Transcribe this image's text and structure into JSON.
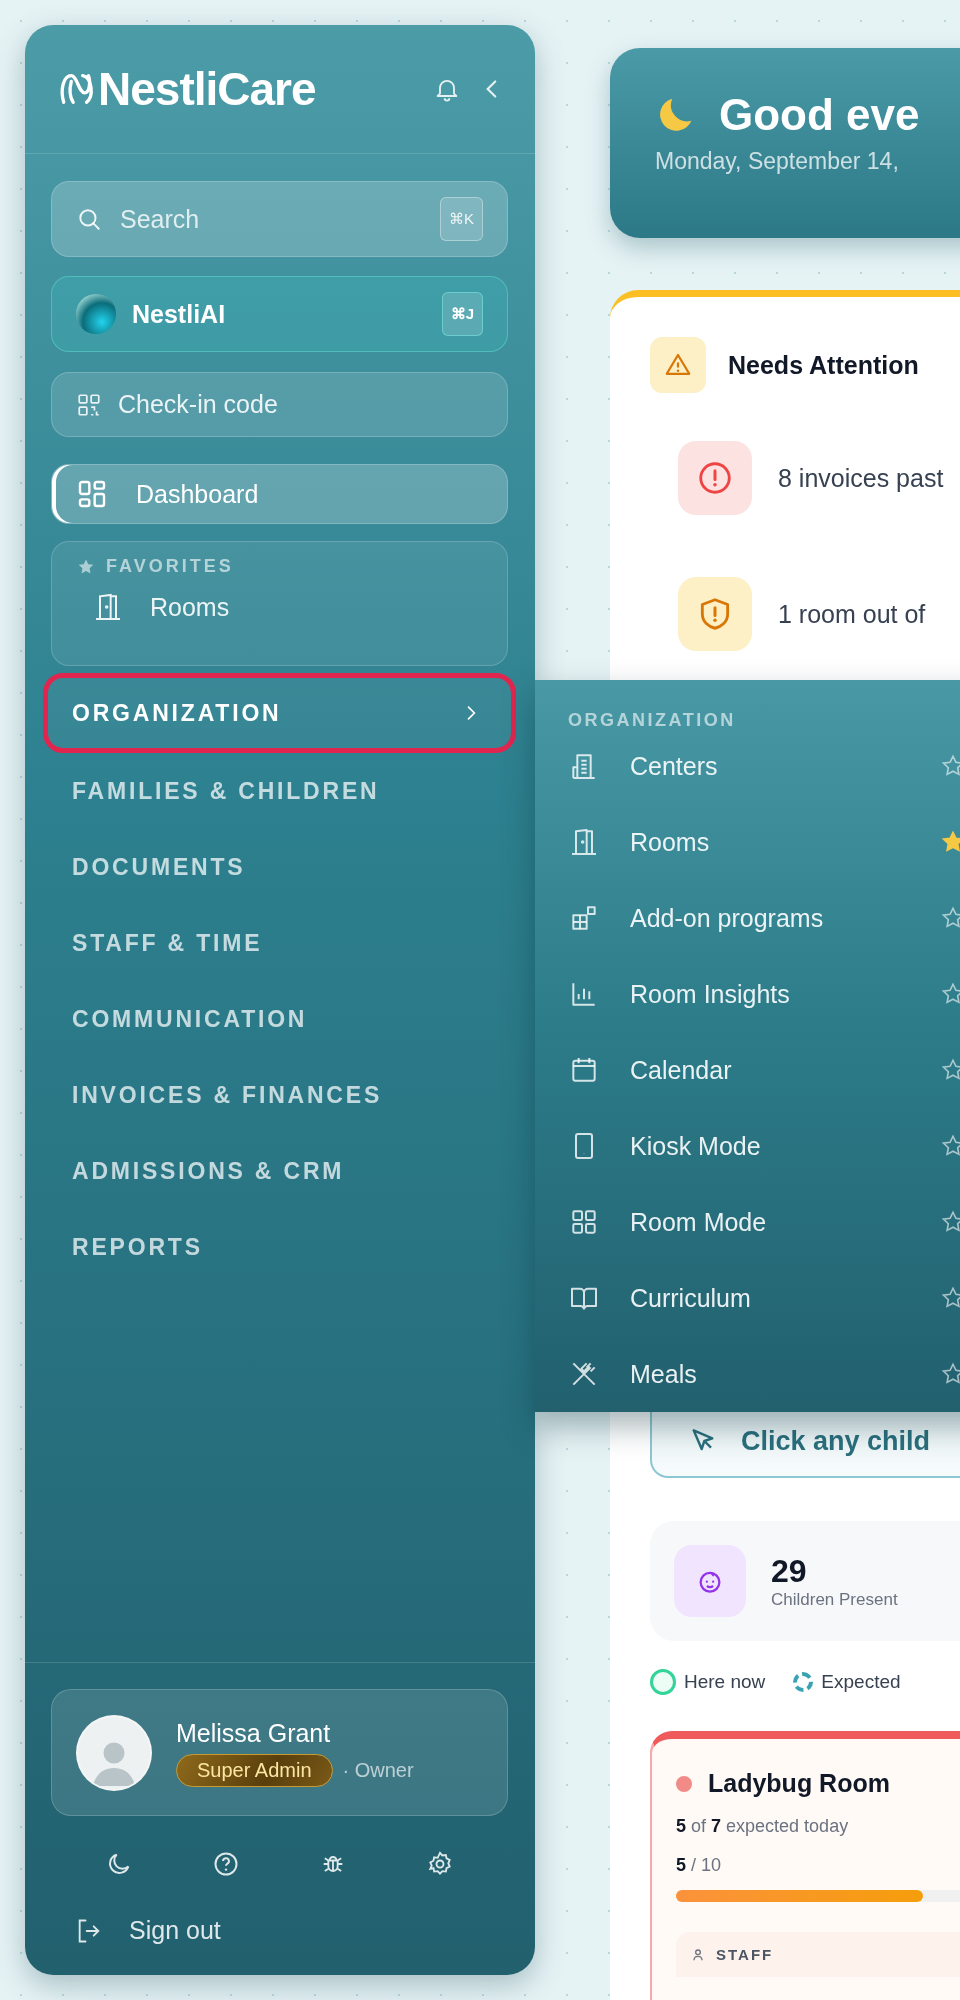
{
  "sidebar": {
    "logo": "NestliCare",
    "search": {
      "placeholder": "Search",
      "shortcut": "⌘K"
    },
    "assistant": {
      "label": "NestliAI",
      "shortcut": "⌘J"
    },
    "checkin": {
      "label": "Check-in code"
    },
    "dashboard": {
      "label": "Dashboard",
      "selected": true
    },
    "favorites": {
      "title": "FAVORITES",
      "items": [
        {
          "label": "Rooms"
        }
      ]
    },
    "sections": [
      {
        "label": "ORGANIZATION",
        "selected": true
      },
      {
        "label": "FAMILIES & CHILDREN",
        "selected": false
      },
      {
        "label": "DOCUMENTS",
        "selected": false
      },
      {
        "label": "STAFF & TIME",
        "selected": false
      },
      {
        "label": "COMMUNICATION",
        "selected": false
      },
      {
        "label": "INVOICES & FINANCES",
        "selected": false
      },
      {
        "label": "ADMISSIONS & CRM",
        "selected": false
      },
      {
        "label": "REPORTS",
        "selected": false
      }
    ],
    "user": {
      "name": "Melissa Grant",
      "role": "Super Admin",
      "title": "· Owner"
    },
    "sign_out": "Sign out"
  },
  "flyout": {
    "title": "ORGANIZATION",
    "items": [
      {
        "label": "Centers",
        "favorite": false
      },
      {
        "label": "Rooms",
        "favorite": true
      },
      {
        "label": "Add-on programs",
        "favorite": false
      },
      {
        "label": "Room Insights",
        "favorite": false
      },
      {
        "label": "Calendar",
        "favorite": false
      },
      {
        "label": "Kiosk Mode",
        "favorite": false
      },
      {
        "label": "Room Mode",
        "favorite": false
      },
      {
        "label": "Curriculum",
        "favorite": false
      },
      {
        "label": "Meals",
        "favorite": false
      }
    ]
  },
  "greeting": {
    "title": "Good eve",
    "date": "Monday, September 14,"
  },
  "attention": {
    "title": "Needs Attention",
    "items": [
      {
        "kind": "danger",
        "text": "8 invoices past"
      },
      {
        "kind": "warning",
        "text": "1 room out of"
      }
    ]
  },
  "hint": "Click any child",
  "stat": {
    "value": "29",
    "label": "Children Present"
  },
  "legend": [
    {
      "kind": "present",
      "label": "Here now"
    },
    {
      "kind": "expected",
      "label": "Expected"
    }
  ],
  "room": {
    "name": "Ladybug Room",
    "color": "#f28b87",
    "expected": "**5** of **7** expected today",
    "capacity": "**5** / 10",
    "level": 0.85,
    "staff_label": "STAFF"
  }
}
